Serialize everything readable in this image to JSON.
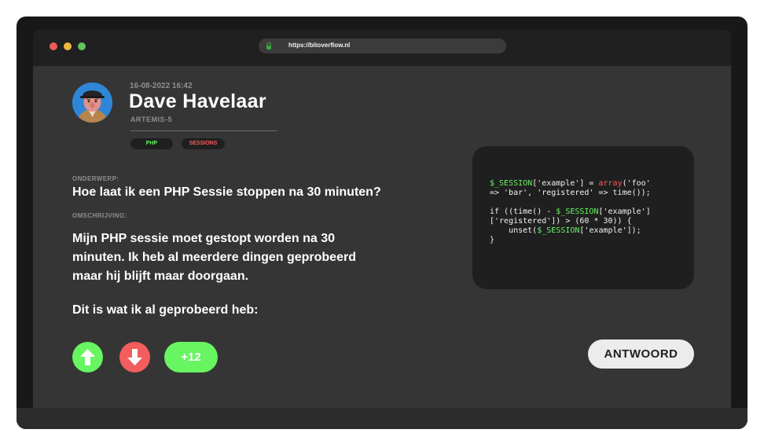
{
  "browser": {
    "url": "https://bitoverflow.nl"
  },
  "post": {
    "date": "16-08-2022 16:42",
    "author": "Dave Havelaar",
    "team": "ARTEMIS-5",
    "tags": [
      "PHP",
      "SESSIONS"
    ],
    "subject_label": "ONDERWERP:",
    "subject": "Hoe laat ik een PHP Sessie stoppen na 30 minuten?",
    "description_label": "OMSCHRIJVING:",
    "description": "Mijn PHP sessie moet gestopt worden na 30 minuten. Ik heb al meerdere dingen geprobeerd maar hij blijft maar doorgaan.",
    "tried_text": "Dit is wat ik al geprobeerd heb:",
    "code_lines": [
      "$_SESSION['example'] = array('foo'",
      "=> 'bar', 'registered' => time());",
      "",
      "if ((time() - $_SESSION['example']",
      "['registered']) > (60 * 30)) {",
      "    unset($_SESSION['example']);",
      "}"
    ]
  },
  "actions": {
    "score": "+12",
    "answer_label": "ANTWOORD"
  },
  "colors": {
    "accent_green": "#67f562",
    "accent_red": "#f35d5d",
    "background": "#353535",
    "code_background": "#1f1f1f"
  },
  "icons": {
    "upvote": "arrow-up-icon",
    "downvote": "arrow-down-icon",
    "lock": "lock-icon",
    "avatar": "avatar-image"
  }
}
